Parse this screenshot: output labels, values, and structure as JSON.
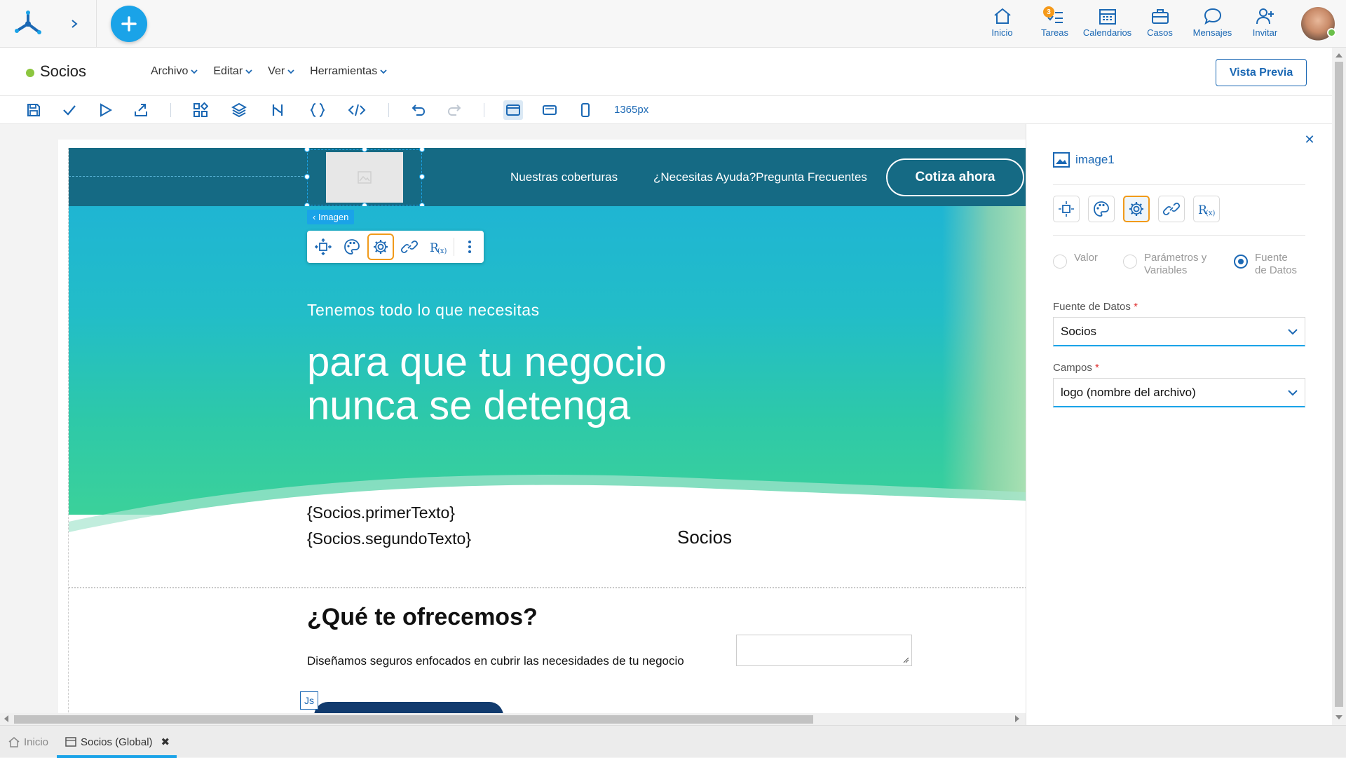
{
  "topbar": {
    "nav": [
      {
        "id": "inicio",
        "label": "Inicio",
        "icon": "home-icon"
      },
      {
        "id": "tareas",
        "label": "Tareas",
        "icon": "tasks-icon",
        "badge": "3"
      },
      {
        "id": "calendarios",
        "label": "Calendarios",
        "icon": "calendar-icon"
      },
      {
        "id": "casos",
        "label": "Casos",
        "icon": "briefcase-icon"
      },
      {
        "id": "mensajes",
        "label": "Mensajes",
        "icon": "chat-icon"
      },
      {
        "id": "invitar",
        "label": "Invitar",
        "icon": "invite-user-icon"
      }
    ]
  },
  "document": {
    "title": "Socios",
    "menus": [
      "Archivo",
      "Editar",
      "Ver",
      "Herramientas"
    ],
    "preview_label": "Vista Previa"
  },
  "toolbar": {
    "width_label": "1365px"
  },
  "canvas": {
    "nav_link_1": "Nuestras coberturas",
    "nav_link_2": "¿Necesitas Ayuda?Pregunta Frecuentes",
    "cta_label": "Cotiza ahora",
    "selected_tag": "Imagen",
    "hero_sub": "Tenemos todo lo que necesitas",
    "hero_title_line1": "para que tu negocio",
    "hero_title_line2": "nunca se detenga",
    "template_text_1": "{Socios.primerTexto}",
    "template_text_2": "{Socios.segundoTexto}",
    "template_socios": "Socios",
    "offer_title": "¿Qué te ofrecemos?",
    "offer_text": "Diseñamos seguros enfocados en cubrir las necesidades de tu negocio",
    "js_badge": "Js"
  },
  "panel": {
    "element_name": "image1",
    "radio_options": [
      {
        "label_line1": "Valor",
        "label_line2": "",
        "selected": false
      },
      {
        "label_line1": "Parámetros y",
        "label_line2": "Variables",
        "selected": false
      },
      {
        "label_line1": "Fuente",
        "label_line2": "de Datos",
        "selected": true
      }
    ],
    "datasource_label": "Fuente de Datos",
    "datasource_value": "Socios",
    "fields_label": "Campos",
    "fields_value": "logo (nombre del archivo)",
    "required_mark": "*"
  },
  "bottom_tabs": [
    {
      "label": "Inicio",
      "active": false
    },
    {
      "label": "Socios (Global)",
      "active": true
    }
  ],
  "colors": {
    "accent": "#1b68b4",
    "fab": "#1aa3e8",
    "highlight": "#f19a1a",
    "site_header": "#156a84"
  }
}
